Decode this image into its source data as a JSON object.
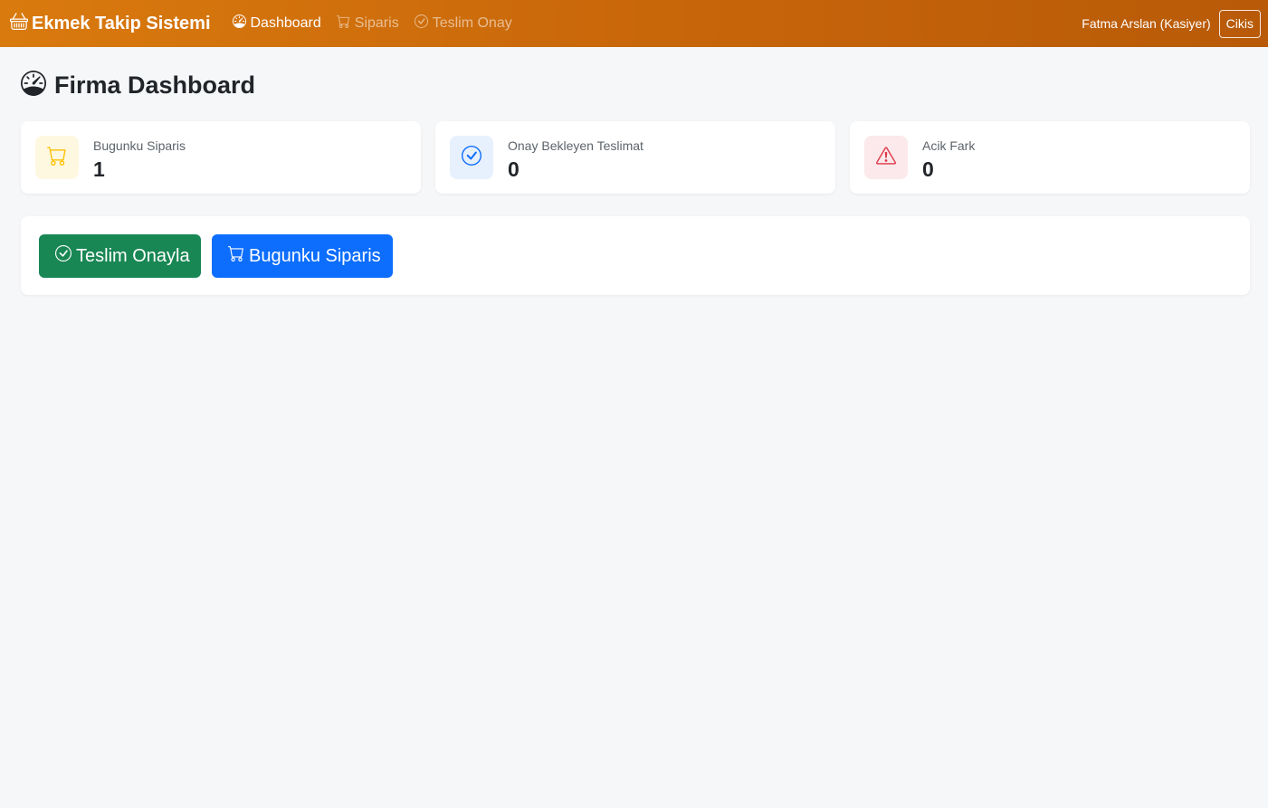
{
  "navbar": {
    "brand": "Ekmek Takip Sistemi",
    "links": [
      {
        "label": "Dashboard",
        "icon": "speedometer-icon",
        "active": true
      },
      {
        "label": "Siparis",
        "icon": "cart-icon",
        "active": false
      },
      {
        "label": "Teslim Onay",
        "icon": "check-circle-icon",
        "active": false
      }
    ],
    "user": "Fatma Arslan (Kasiyer)",
    "logout_label": "Cikis"
  },
  "page": {
    "title": "Firma Dashboard",
    "title_icon": "speedometer-icon"
  },
  "stats": [
    {
      "label": "Bugunku Siparis",
      "value": "1",
      "icon": "cart-icon",
      "color": "#ffc107",
      "bg": "#fff8e1"
    },
    {
      "label": "Onay Bekleyen Teslimat",
      "value": "0",
      "icon": "check-circle-icon",
      "color": "#0d6efd",
      "bg": "#e7f0fd"
    },
    {
      "label": "Acik Fark",
      "value": "0",
      "icon": "warning-icon",
      "color": "#dc3545",
      "bg": "#fbe9eb"
    }
  ],
  "actions": [
    {
      "label": "Teslim Onayla",
      "icon": "check-circle-icon",
      "color": "#198754"
    },
    {
      "label": "Bugunku Siparis",
      "icon": "cart-icon",
      "color": "#0d6efd"
    }
  ],
  "colors": {
    "navbar_start": "#d97a0e",
    "navbar_end": "#b85a08",
    "background": "#f6f7f9"
  }
}
